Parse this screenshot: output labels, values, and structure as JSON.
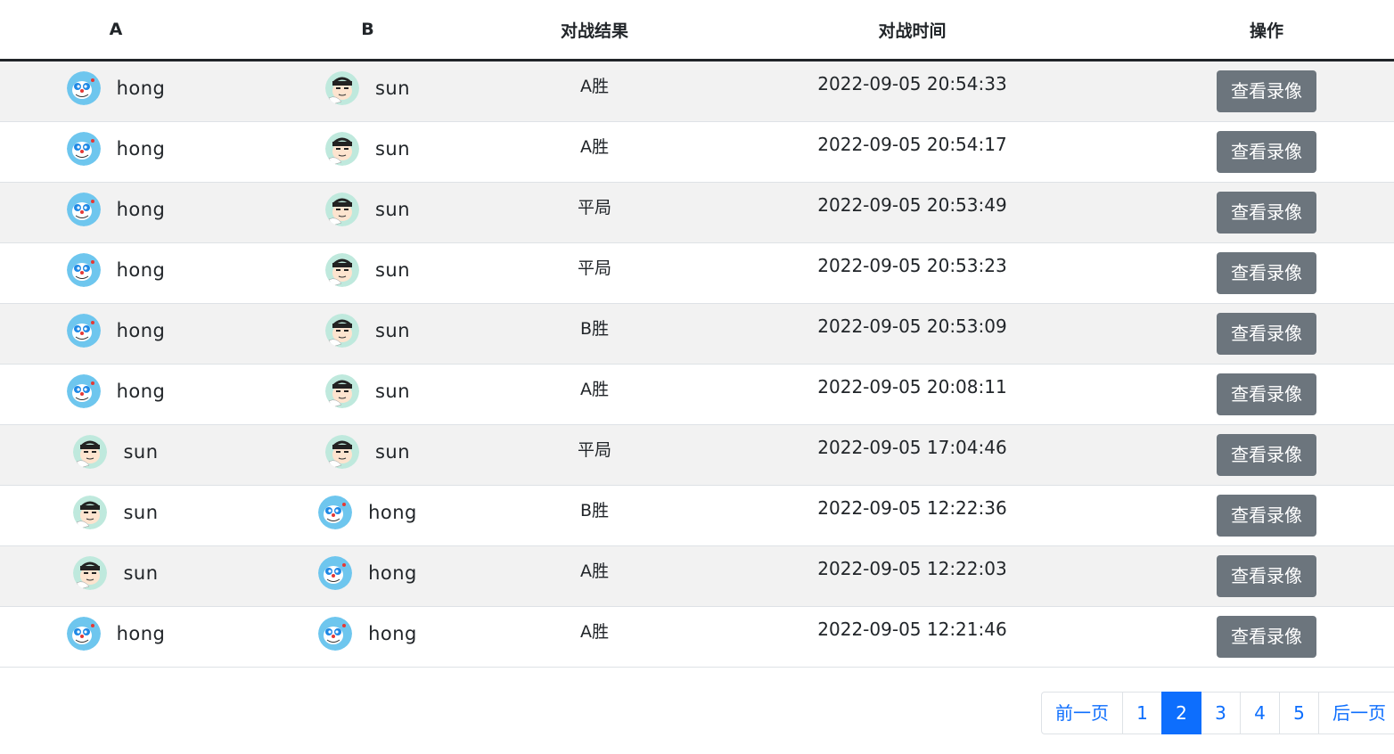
{
  "table": {
    "headers": [
      "A",
      "B",
      "对战结果",
      "对战时间",
      "操作"
    ],
    "rows": [
      {
        "a_name": "hong",
        "a_avatar": "doraemon-avatar",
        "b_name": "sun",
        "b_avatar": "boy-avatar",
        "result": "A胜",
        "time": "2022-09-05 20:54:33",
        "action": "查看录像"
      },
      {
        "a_name": "hong",
        "a_avatar": "doraemon-avatar",
        "b_name": "sun",
        "b_avatar": "boy-avatar",
        "result": "A胜",
        "time": "2022-09-05 20:54:17",
        "action": "查看录像"
      },
      {
        "a_name": "hong",
        "a_avatar": "doraemon-avatar",
        "b_name": "sun",
        "b_avatar": "boy-avatar",
        "result": "平局",
        "time": "2022-09-05 20:53:49",
        "action": "查看录像"
      },
      {
        "a_name": "hong",
        "a_avatar": "doraemon-avatar",
        "b_name": "sun",
        "b_avatar": "boy-avatar",
        "result": "平局",
        "time": "2022-09-05 20:53:23",
        "action": "查看录像"
      },
      {
        "a_name": "hong",
        "a_avatar": "doraemon-avatar",
        "b_name": "sun",
        "b_avatar": "boy-avatar",
        "result": "B胜",
        "time": "2022-09-05 20:53:09",
        "action": "查看录像"
      },
      {
        "a_name": "hong",
        "a_avatar": "doraemon-avatar",
        "b_name": "sun",
        "b_avatar": "boy-avatar",
        "result": "A胜",
        "time": "2022-09-05 20:08:11",
        "action": "查看录像"
      },
      {
        "a_name": "sun",
        "a_avatar": "boy-avatar",
        "b_name": "sun",
        "b_avatar": "boy-avatar",
        "result": "平局",
        "time": "2022-09-05 17:04:46",
        "action": "查看录像"
      },
      {
        "a_name": "sun",
        "a_avatar": "boy-avatar",
        "b_name": "hong",
        "b_avatar": "doraemon-avatar",
        "result": "B胜",
        "time": "2022-09-05 12:22:36",
        "action": "查看录像"
      },
      {
        "a_name": "sun",
        "a_avatar": "boy-avatar",
        "b_name": "hong",
        "b_avatar": "doraemon-avatar",
        "result": "A胜",
        "time": "2022-09-05 12:22:03",
        "action": "查看录像"
      },
      {
        "a_name": "hong",
        "a_avatar": "doraemon-avatar",
        "b_name": "hong",
        "b_avatar": "doraemon-avatar",
        "result": "A胜",
        "time": "2022-09-05 12:21:46",
        "action": "查看录像"
      }
    ]
  },
  "pagination": {
    "prev_label": "前一页",
    "next_label": "后一页",
    "pages": [
      "1",
      "2",
      "3",
      "4",
      "5"
    ],
    "active_page": "2"
  },
  "colors": {
    "button_bg": "#6c757d",
    "link": "#0d6efd",
    "active_page_bg": "#0d6efd",
    "stripe": "#f2f2f2"
  }
}
